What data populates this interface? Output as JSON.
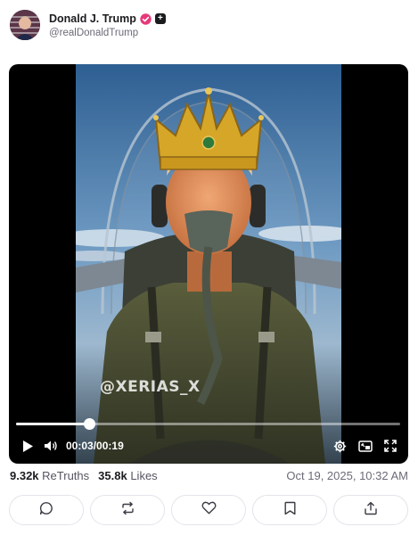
{
  "post": {
    "author": {
      "display_name": "Donald J. Trump",
      "handle": "@realDonaldTrump",
      "verified_color": "#e6397a"
    },
    "video": {
      "watermark": "@XERIAS_X",
      "current_time": "00:03",
      "separator": "/",
      "duration": "00:19",
      "progress": 0.19
    },
    "stats": {
      "retruths_count": "9.32k",
      "retruths_label": "ReTruths",
      "likes_count": "35.8k",
      "likes_label": "Likes"
    },
    "timestamp": "Oct 19, 2025, 10:32 AM"
  },
  "icons": {
    "play": "play-icon",
    "volume": "volume-icon",
    "settings": "gear-icon",
    "pip": "picture-in-picture-icon",
    "fullscreen": "fullscreen-icon",
    "reply": "reply-icon",
    "retruth": "retruth-icon",
    "like": "heart-icon",
    "bookmark": "bookmark-icon",
    "share": "share-icon"
  },
  "colors": {
    "accent_verified": "#e6397a",
    "text_primary": "#1b1b1f",
    "text_muted": "#6b6b78"
  }
}
